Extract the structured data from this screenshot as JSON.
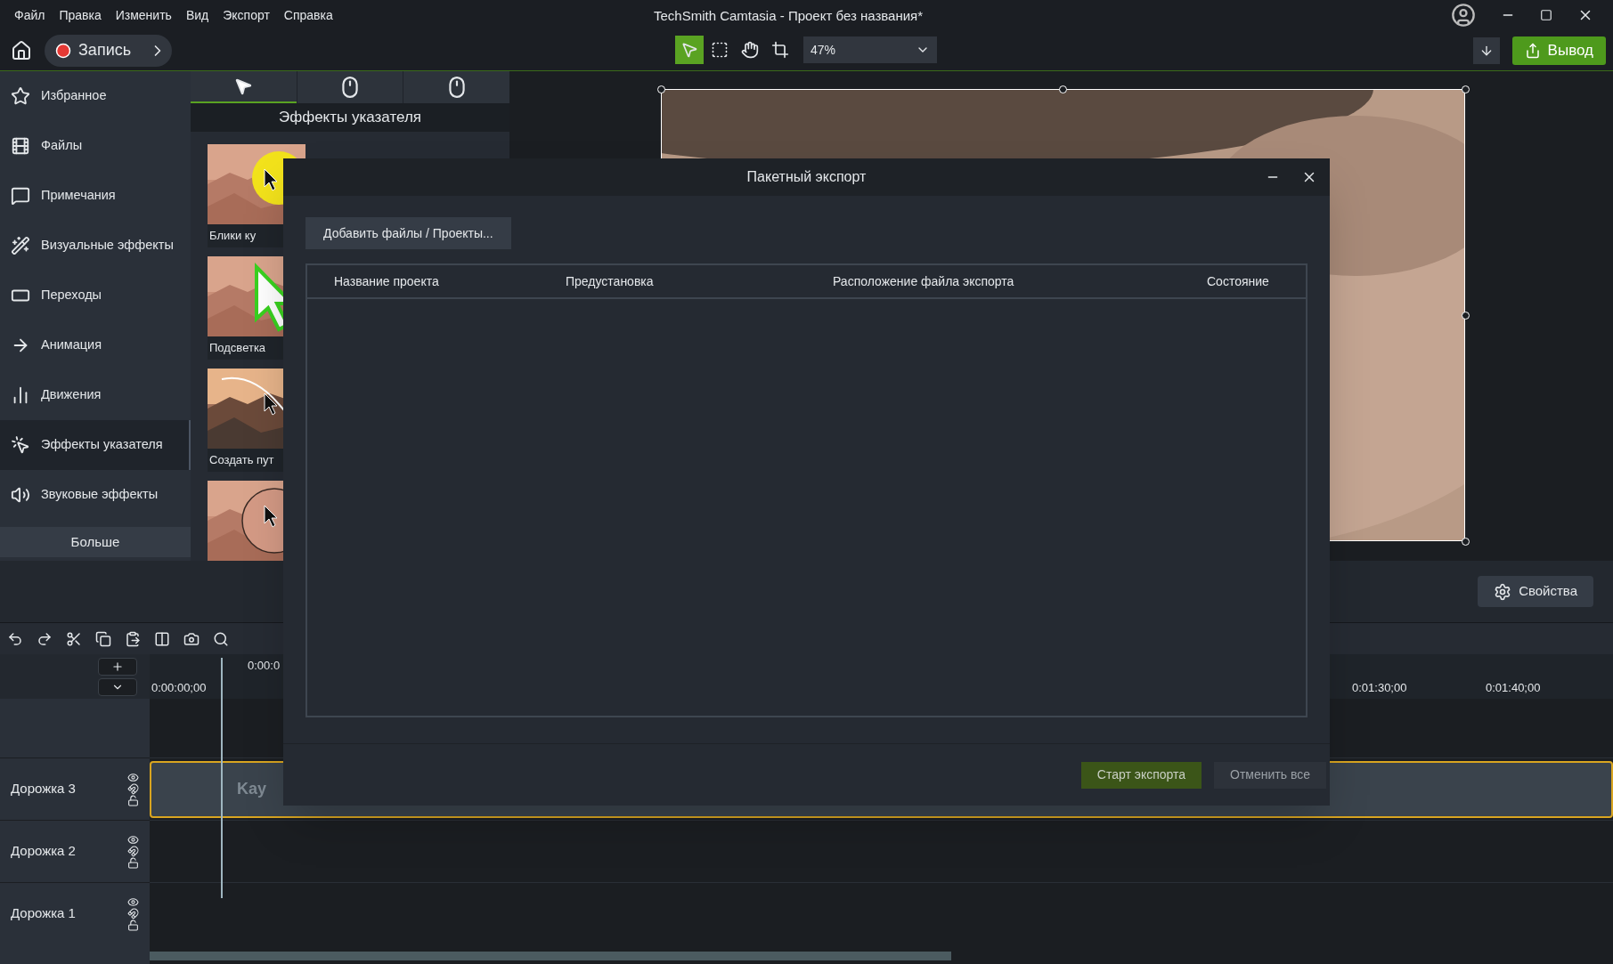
{
  "menu": [
    "Файл",
    "Правка",
    "Изменить",
    "Вид",
    "Экспорт",
    "Справка"
  ],
  "window": {
    "title": "TechSmith Camtasia - Проект без названия*"
  },
  "toolbar": {
    "record": "Запись",
    "zoom": "47%",
    "export": "Вывод",
    "tools": [
      {
        "kind": "select",
        "selected": true
      },
      {
        "kind": "transform",
        "selected": false
      },
      {
        "kind": "pan",
        "selected": false
      },
      {
        "kind": "crop",
        "selected": false
      }
    ]
  },
  "sidebar": {
    "items": [
      {
        "label": "Избранное",
        "kind": "star",
        "selected": false
      },
      {
        "label": "Файлы",
        "kind": "film",
        "selected": false
      },
      {
        "label": "Примечания",
        "kind": "note",
        "selected": false
      },
      {
        "label": "Визуальные эффекты",
        "kind": "wand",
        "selected": false
      },
      {
        "label": "Переходы",
        "kind": "transition",
        "selected": false
      },
      {
        "label": "Анимация",
        "kind": "arrow",
        "selected": false
      },
      {
        "label": "Движения",
        "kind": "motion",
        "selected": false
      },
      {
        "label": "Эффекты указателя",
        "kind": "cursor",
        "selected": true
      },
      {
        "label": "Звуковые эффекты",
        "kind": "audio",
        "selected": false
      }
    ],
    "more": "Больше"
  },
  "effects": {
    "tabs": [
      {
        "kind": "pointer",
        "selected": true
      },
      {
        "kind": "left-click",
        "selected": false
      },
      {
        "kind": "right-click",
        "selected": false
      }
    ],
    "title": "Эффекты указателя",
    "items": [
      {
        "label": "Блики ку",
        "kind": "highlight"
      },
      {
        "label": "Подсветка",
        "kind": "glow"
      },
      {
        "label": "Создать пут",
        "kind": "path"
      },
      {
        "kind": "magnify"
      }
    ]
  },
  "properties": {
    "label": "Свойства"
  },
  "timeline": {
    "playhead": "0:00:0",
    "ruler": [
      "0:00:00;00",
      "0:01:30;00",
      "0:01:40;00"
    ],
    "tracks": [
      {
        "label": "Дорожка 3",
        "clip": "Kay"
      },
      {
        "label": "Дорожка 2"
      },
      {
        "label": "Дорожка 1"
      }
    ]
  },
  "dialog": {
    "title": "Пакетный экспорт",
    "add_button": "Добавить файлы / Проекты...",
    "columns": [
      "Название проекта",
      "Предустановка",
      "Расположение файла экспорта",
      "Состояние"
    ],
    "start_button": "Старт экспорта",
    "cancel_button": "Отменить все"
  }
}
